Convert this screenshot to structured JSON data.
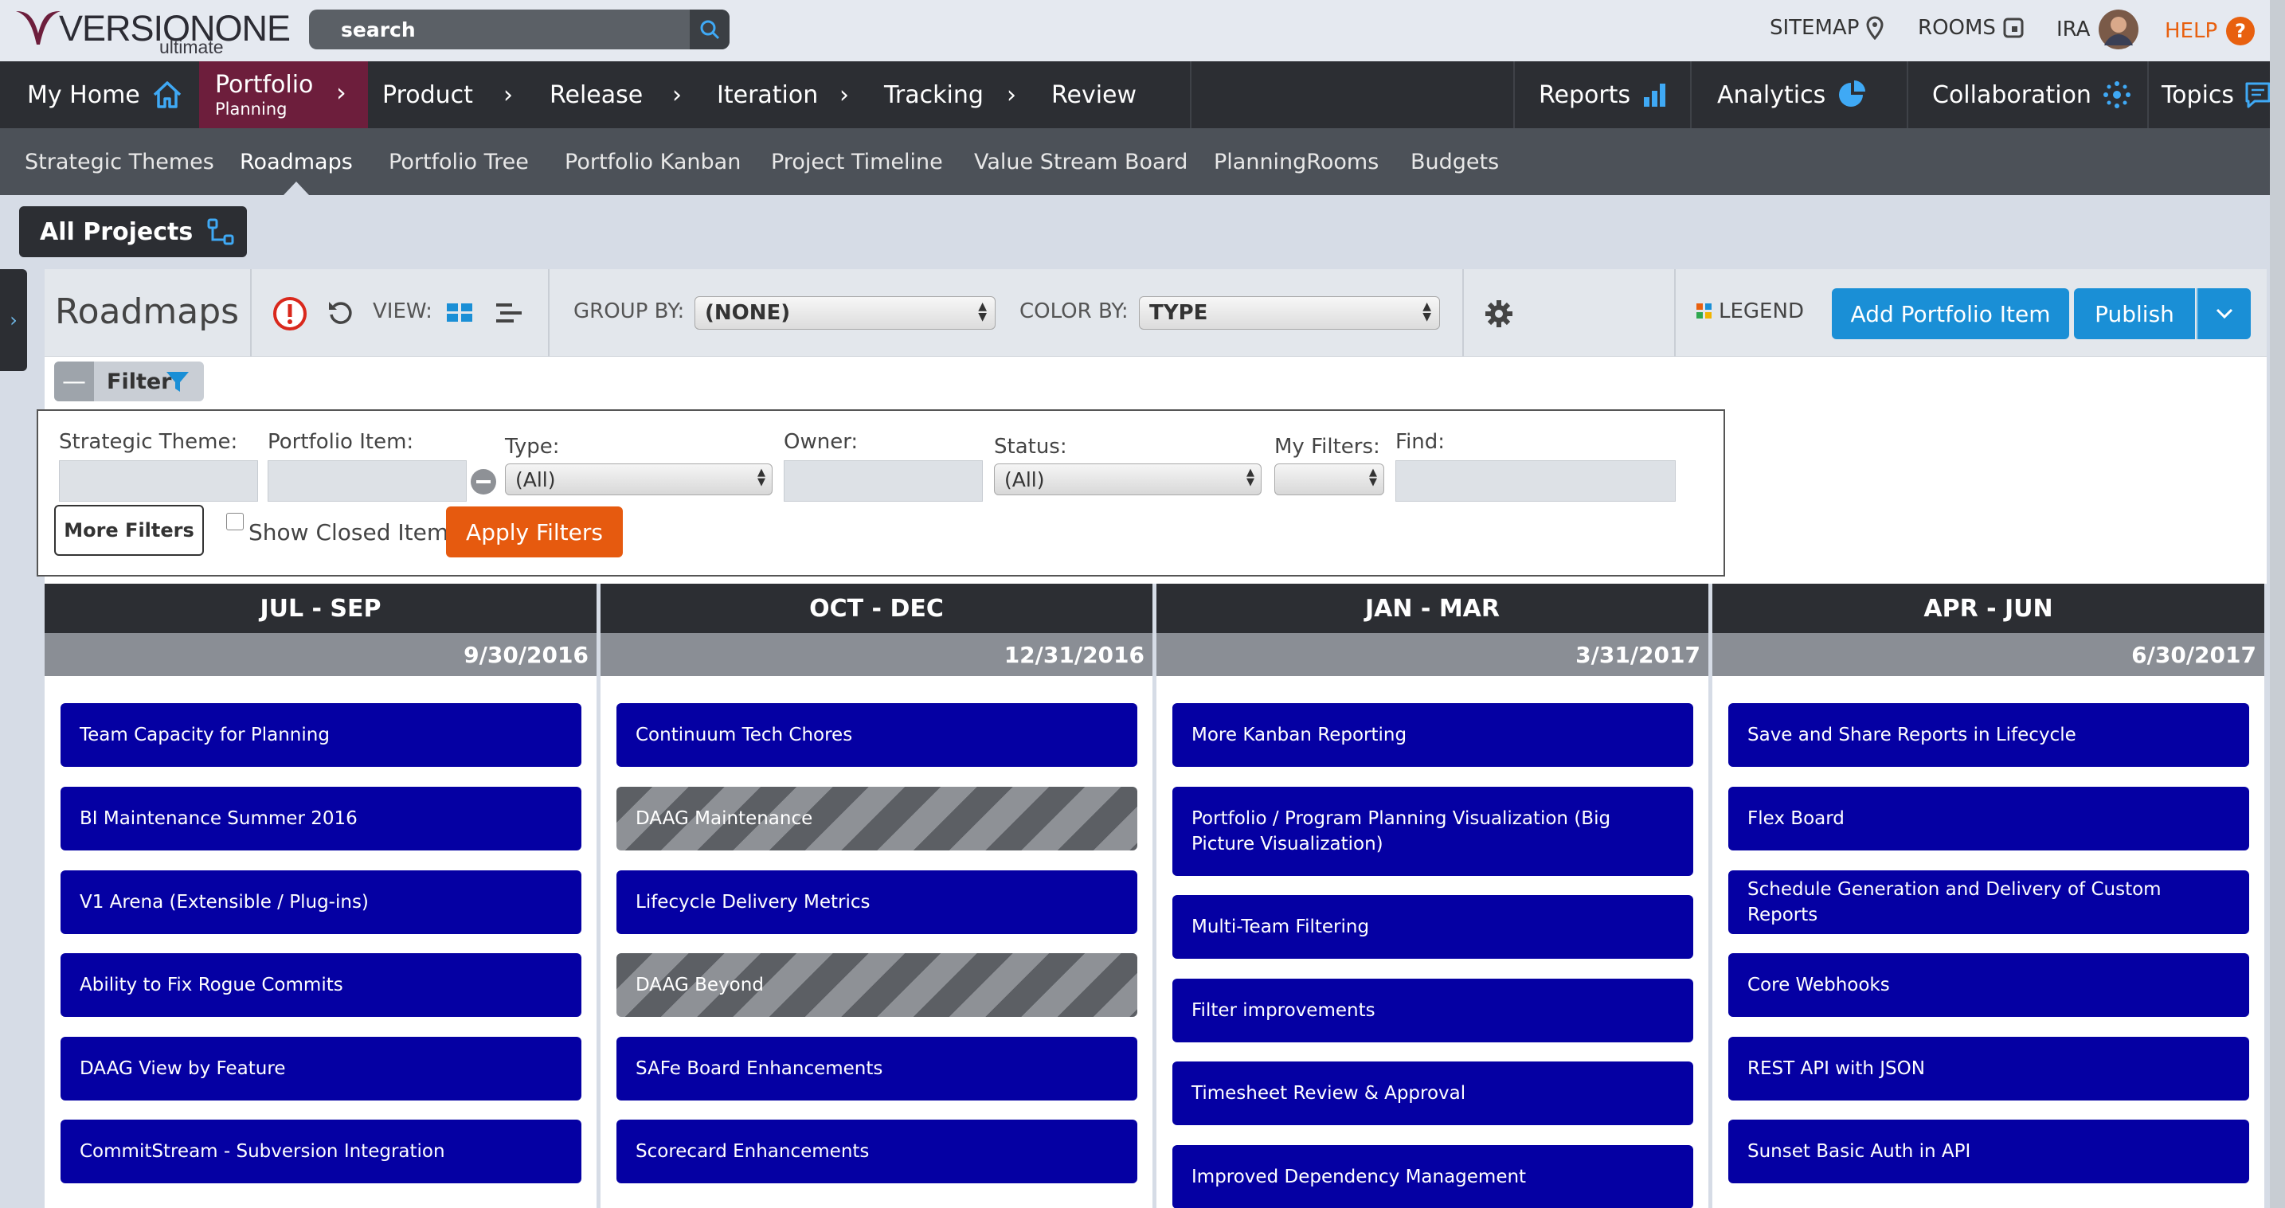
{
  "brand": {
    "name": "VERSIONONE",
    "edition": "ultimate"
  },
  "search": {
    "placeholder": "search",
    "value": ""
  },
  "utility": {
    "sitemap": "SITEMAP",
    "rooms": "ROOMS",
    "user": "IRA",
    "help": "HELP"
  },
  "nav": {
    "home": "My Home",
    "portfolio": "Portfolio",
    "portfolio_sub": "Planning",
    "product": "Product",
    "release": "Release",
    "iteration": "Iteration",
    "tracking": "Tracking",
    "review": "Review",
    "reports": "Reports",
    "analytics": "Analytics",
    "collaboration": "Collaboration",
    "topics": "Topics"
  },
  "subnav": [
    "Strategic Themes",
    "Roadmaps",
    "Portfolio Tree",
    "Portfolio Kanban",
    "Project Timeline",
    "Value Stream Board",
    "PlanningRooms",
    "Budgets"
  ],
  "project": "All Projects",
  "toolbar": {
    "title": "Roadmaps",
    "view_label": "VIEW:",
    "group_label": "GROUP BY:",
    "group_value": "(NONE)",
    "color_label": "COLOR BY:",
    "color_value": "TYPE",
    "legend": "LEGEND",
    "add": "Add Portfolio Item",
    "publish": "Publish"
  },
  "filter": {
    "label": "Filter",
    "strategic_theme": "Strategic Theme:",
    "portfolio_item": "Portfolio Item:",
    "type": "Type:",
    "type_value": "(All)",
    "owner": "Owner:",
    "status": "Status:",
    "status_value": "(All)",
    "my_filters": "My Filters:",
    "find": "Find:",
    "more": "More Filters",
    "show_closed": "Show Closed Items",
    "apply": "Apply Filters"
  },
  "columns": [
    {
      "title": "JUL - SEP",
      "date": "9/30/2016",
      "cards": [
        "Team Capacity for Planning",
        "BI Maintenance Summer 2016",
        "V1 Arena (Extensible / Plug-ins)",
        "Ability to Fix Rogue Commits",
        "DAAG View by Feature",
        "CommitStream - Subversion Integration"
      ]
    },
    {
      "title": "OCT - DEC",
      "date": "12/31/2016",
      "cards": [
        "Continuum Tech Chores",
        "DAAG Maintenance",
        "Lifecycle Delivery Metrics",
        "DAAG Beyond",
        "SAFe Board Enhancements",
        "Scorecard Enhancements"
      ]
    },
    {
      "title": "JAN - MAR",
      "date": "3/31/2017",
      "cards": [
        "More Kanban Reporting",
        "Portfolio / Program Planning Visualization (Big Picture Visualization)",
        "Multi-Team Filtering",
        "Filter improvements",
        "Timesheet Review & Approval",
        "Improved Dependency Management"
      ]
    },
    {
      "title": "APR - JUN",
      "date": "6/30/2017",
      "cards": [
        "Save and Share Reports in Lifecycle",
        "Flex Board",
        "Schedule Generation and Delivery of Custom Reports",
        "Core Webhooks",
        "REST API with JSON",
        "Sunset Basic Auth in API"
      ]
    }
  ],
  "colors": {
    "accent": "#1a8fd6",
    "portfolio": "#6d1e3c",
    "card": "#0500a3",
    "apply": "#e65a0f",
    "help": "#e8600f",
    "nav": "#2c2e33"
  }
}
